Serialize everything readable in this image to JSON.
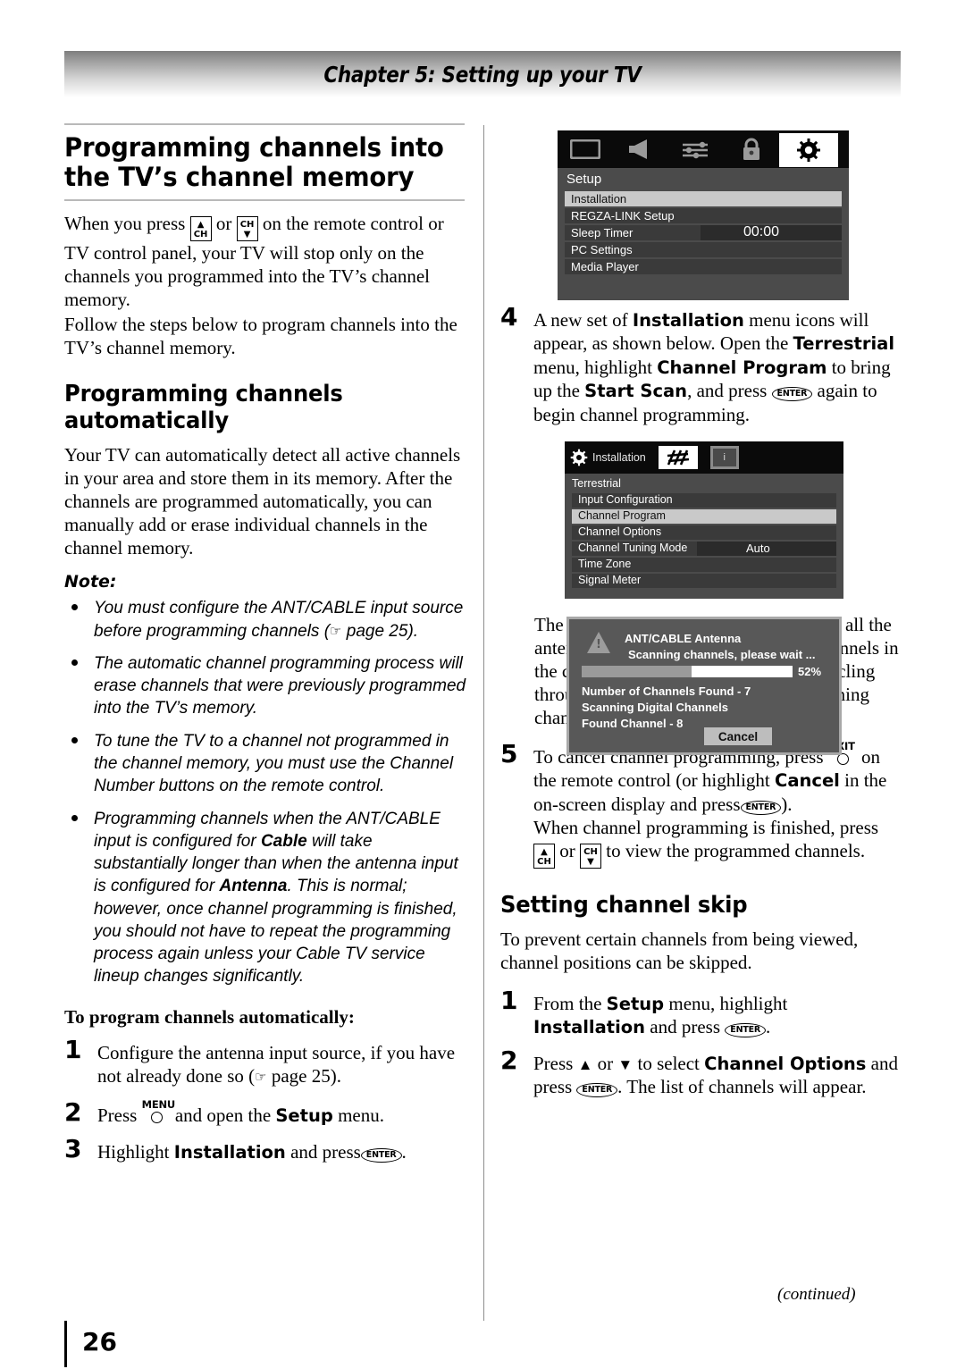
{
  "header": {
    "chapter_title": "Chapter 5: Setting up your TV"
  },
  "footer": {
    "continued": "(continued)",
    "page_number": "26"
  },
  "left": {
    "h1": "Programming channels into the TV’s channel memory",
    "intro_a1": "When you press",
    "intro_or": "or",
    "intro_a2": "on the remote control or TV control panel, your TV will stop only on the channels you programmed into the TV’s channel memory.",
    "intro_b": "Follow the steps below to program channels into the TV’s channel memory.",
    "h2_auto": "Programming channels automatically",
    "auto_para": "Your TV can automatically detect all active channels in your area and store them in its memory. After the channels are programmed automatically, you can manually add or erase individual channels in the channel memory.",
    "note_label": "Note:",
    "notes": [
      {
        "a": "You must configure the ANT/CABLE input source before programming channels (",
        "b": "page 25)."
      },
      {
        "a": "The automatic channel programming process will erase channels that were previously programmed into the TV’s memory."
      },
      {
        "a": "To tune the TV to a channel not programmed in the channel memory, you must use the Channel Number buttons on the remote control."
      },
      {
        "a": "Programming channels when the ANT/CABLE input is configured for ",
        "bold1": "Cable",
        "b": " will take substantially longer than when the antenna input is configured for ",
        "bold2": "Antenna",
        "c": ". This is normal; however, once channel programming is finished, you should not have to repeat the programming process again unless your Cable TV service lineup changes significantly."
      }
    ],
    "h3_steps": "To program channels automatically:",
    "step1_num": "1",
    "step1_a": "Configure the antenna input source, if you have not already done so (",
    "step1_b": "page 25).",
    "step2_num": "2",
    "step2_a": "Press",
    "step2_b": "and open the",
    "step2_bold": "Setup",
    "step2_c": "menu.",
    "step3_num": "3",
    "step3_a": "Highlight",
    "step3_bold": "Installation",
    "step3_b": "and press",
    "step3_c": "."
  },
  "osd_setup": {
    "icons": [
      "picture-icon",
      "audio-icon",
      "preferences-icon",
      "lock-icon",
      "setup-gear-icon"
    ],
    "active_icon_index": 4,
    "title": "Setup",
    "rows": [
      {
        "label": "Installation",
        "value": "",
        "selected": true,
        "split": false
      },
      {
        "label": "REGZA-LINK Setup",
        "value": "",
        "selected": false,
        "split": false
      },
      {
        "label": "Sleep Timer",
        "value": "00:00",
        "selected": false,
        "split": true
      },
      {
        "label": "PC Settings",
        "value": "",
        "selected": false,
        "split": false
      },
      {
        "label": "Media Player",
        "value": "",
        "selected": false,
        "split": false
      }
    ]
  },
  "osd_installation": {
    "bar_label": "Installation",
    "title": "Terrestrial",
    "rows": [
      {
        "label": "Input Configuration",
        "value": "",
        "selected": false,
        "split": false
      },
      {
        "label": "Channel Program",
        "value": "",
        "selected": true,
        "split": false
      },
      {
        "label": "Channel Options",
        "value": "",
        "selected": false,
        "split": false
      },
      {
        "label": "Channel Tuning Mode",
        "value": "Auto",
        "selected": false,
        "split": true
      },
      {
        "label": "Time Zone",
        "value": "",
        "selected": false,
        "split": false
      },
      {
        "label": "Signal Meter",
        "value": "",
        "selected": false,
        "split": false
      }
    ]
  },
  "scan_dialog": {
    "source_label": "ANT/CABLE   Antenna",
    "status": "Scanning channels, please wait ...",
    "progress_percent": "52%",
    "progress_value": 52,
    "line1": "Number of Channels Found - 7",
    "line2": "Scanning Digital Channels",
    "line3": "Found Channel - 8",
    "cancel_label": "Cancel"
  },
  "right": {
    "step4_num": "4",
    "step4_a": "A new set of",
    "step4_b1": "Installation",
    "step4_c": "menu icons will appear, as shown below. Open the",
    "step4_b2": "Terrestrial",
    "step4_d": "menu, highlight",
    "step4_b3": "Channel Program",
    "step4_e": "to bring up the",
    "step4_b4": "Start Scan",
    "step4_f": ", and press",
    "step4_g": "again to begin channel programming.",
    "after_scan_para": "The TV will automatically cycle through all the antenna channels and store all active channels in the channel memory. While the TV is cycling through the channels the message “Scanning channels, please wait” appears.",
    "step5_num": "5",
    "step5_a": "To cancel channel programming, press",
    "step5_b": "on the remote control (or highlight",
    "step5_bold": "Cancel",
    "step5_c": "in the on-screen display and press",
    "step5_d": ").",
    "step5_e": "When channel programming is finished, press",
    "step5_f": "or",
    "step5_g": "to view the programmed channels.",
    "h2_skip": "Setting channel skip",
    "skip_para": "To prevent certain channels from being viewed, channel positions can be skipped.",
    "skip1_num": "1",
    "skip1_a": "From the",
    "skip1_bold1": "Setup",
    "skip1_b": "menu, highlight",
    "skip1_bold2": "Installation",
    "skip1_c": "and press",
    "skip1_d": ".",
    "skip2_num": "2",
    "skip2_a": "Press",
    "skip2_up": "▲",
    "skip2_or": "or",
    "skip2_dn": "▼",
    "skip2_b": "to select",
    "skip2_bold": "Channel Options",
    "skip2_c": "and press",
    "skip2_d": ". The list of channels will appear."
  },
  "keys": {
    "enter": "ENTER",
    "menu": "MENU",
    "exit": "EXIT",
    "ch": "CH",
    "up": "▲",
    "down": "▼",
    "hand": "☞"
  },
  "colors": {
    "osd_background": "#4b4b4b",
    "osd_bar": "#0a0a0a",
    "osd_row": "#3a3a3a",
    "osd_row_selected": "#c9c9c9",
    "dialog_background": "#585858",
    "dialog_border": "#a8a8a8",
    "progress_fill": "#9a9a9a"
  }
}
